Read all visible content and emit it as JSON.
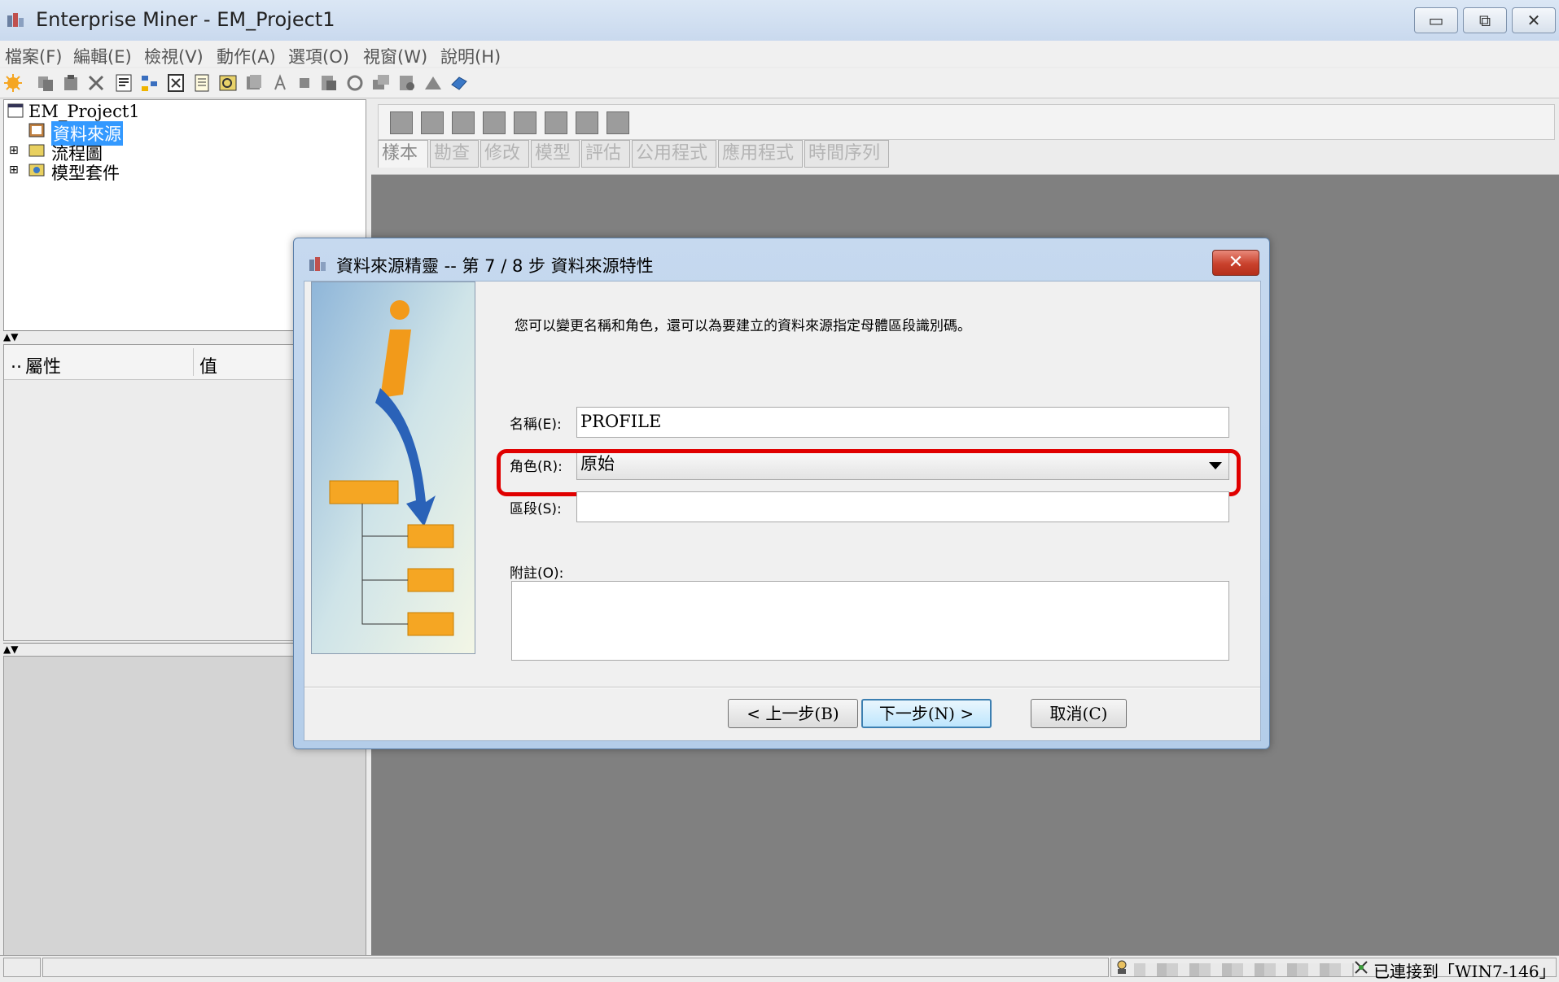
{
  "window": {
    "title": "Enterprise Miner - EM_Project1",
    "buttons": {
      "minimize": "▭",
      "restore": "⧉",
      "close": "✕"
    }
  },
  "menu": [
    "檔案(F)",
    "編輯(E)",
    "檢視(V)",
    "動作(A)",
    "選項(O)",
    "視窗(W)",
    "說明(H)"
  ],
  "toolbar": {
    "icons": [
      "new-icon",
      "copy-icon",
      "paste-icon",
      "delete-icon",
      "properties-icon",
      "diagram-icon",
      "export-icon",
      "notes-icon",
      "search-icon",
      "library-icon",
      "run-icon",
      "stop-icon",
      "results-icon",
      "refresh-icon",
      "layout-icon",
      "find-icon",
      "model-icon",
      "help-icon"
    ]
  },
  "tree": {
    "project": "EM_Project1",
    "items": [
      {
        "label": "資料來源",
        "selected": true
      },
      {
        "label": "流程圖",
        "selected": false
      },
      {
        "label": "模型套件",
        "selected": false
      }
    ]
  },
  "properties": {
    "col_dots": "..",
    "col_property": "屬性",
    "col_value": "值"
  },
  "splitter_arrows": "▲▼",
  "palette": {
    "tabs": [
      "樣本",
      "勘查",
      "修改",
      "模型",
      "評估",
      "公用程式",
      "應用程式",
      "時間序列"
    ],
    "active_tab": "樣本"
  },
  "dialog": {
    "title": "資料來源精靈 -- 第 7 / 8 步 資料來源特性",
    "close_label": "✕",
    "intro": "您可以變更名稱和角色，還可以為要建立的資料來源指定母體區段識別碼。",
    "name_label": "名稱(E):",
    "name_value": "PROFILE",
    "role_label": "角色(R):",
    "role_value": "原始",
    "segment_label": "區段(S):",
    "segment_value": "",
    "notes_label": "附註(O):",
    "notes_value": "",
    "back_button": "< 上一步(B)",
    "next_button": "下一步(N) >",
    "cancel_button": "取消(C)",
    "highlight_color": "#e00000"
  },
  "status": {
    "connection": "已連接到「WIN7-146」"
  }
}
